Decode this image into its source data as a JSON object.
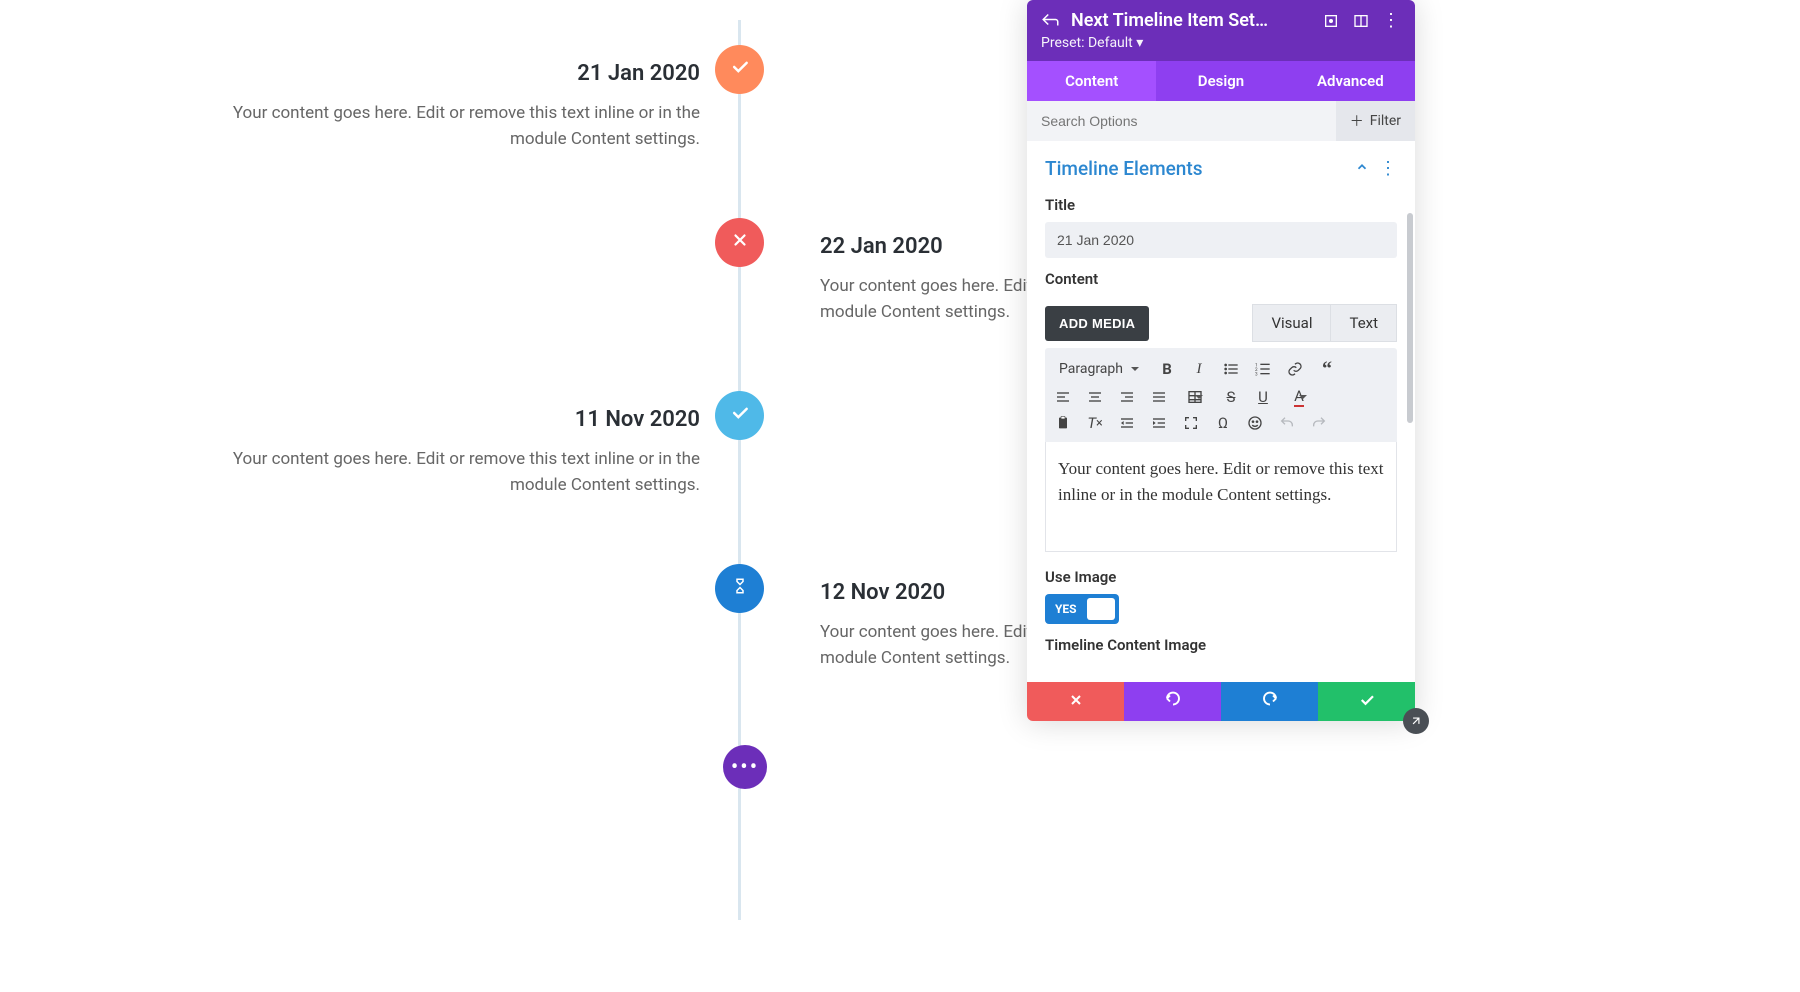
{
  "timeline": {
    "items": [
      {
        "title": "21 Jan 2020",
        "desc": "Your content goes here. Edit or remove this text inline or in the module Content settings.",
        "side": "left",
        "badge_color": "badge-orange",
        "icon": "check"
      },
      {
        "title": "22 Jan 2020",
        "desc": "Your content goes here. Edit o\nmodule Content settings.",
        "side": "right",
        "badge_color": "badge-red",
        "icon": "x"
      },
      {
        "title": "11 Nov 2020",
        "desc": "Your content goes here. Edit or remove this text inline or in the module Content settings.",
        "side": "left",
        "badge_color": "badge-sky",
        "icon": "check"
      },
      {
        "title": "12 Nov 2020",
        "desc": "Your content goes here. Edit o\nmodule Content settings.",
        "side": "right",
        "badge_color": "badge-blue",
        "icon": "hourglass"
      }
    ]
  },
  "panel": {
    "title": "Next Timeline Item Set…",
    "preset_label": "Preset: Default ▾",
    "tabs": {
      "content": "Content",
      "design": "Design",
      "advanced": "Advanced"
    },
    "search_placeholder": "Search Options",
    "filter_label": "Filter",
    "section_title": "Timeline Elements",
    "fields": {
      "title_label": "Title",
      "title_value": "21 Jan 2020",
      "content_label": "Content",
      "add_media": "ADD MEDIA",
      "editor_tabs": {
        "visual": "Visual",
        "text": "Text"
      },
      "format_select": "Paragraph",
      "editor_value": "Your content goes here. Edit or remove this text inline or in the module Content settings.",
      "use_image_label": "Use Image",
      "use_image_value": "YES",
      "timeline_img_label": "Timeline Content Image"
    }
  }
}
